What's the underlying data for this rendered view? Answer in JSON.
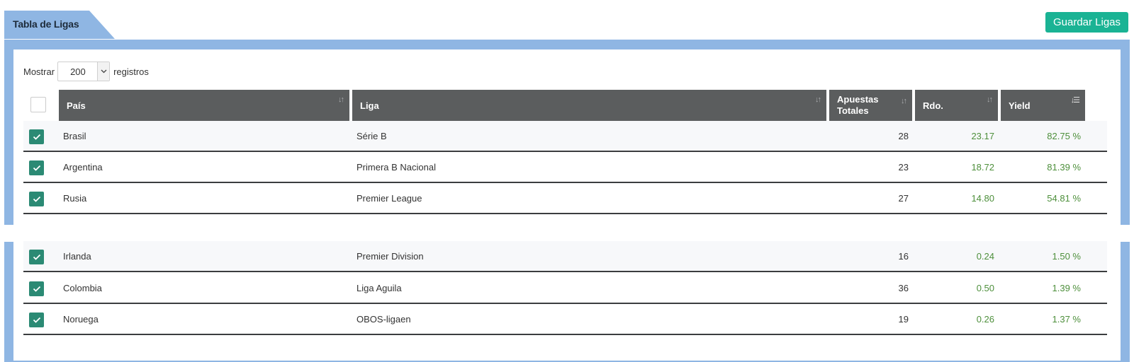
{
  "header": {
    "title": "Tabla de Ligas",
    "save_label": "Guardar Ligas"
  },
  "length": {
    "prefix": "Mostrar",
    "value": "200",
    "suffix": "registros"
  },
  "columns": {
    "pais": "País",
    "liga": "Liga",
    "apuestas_1": "Apuestas",
    "apuestas_2": "Totales",
    "rdo": "Rdo.",
    "yield": "Yield"
  },
  "colors": {
    "accent": "#1ab394",
    "frame": "#8fb6e3",
    "header_bg": "#5b5d5e",
    "checkbox": "#2b8a74",
    "positive": "#4d8f3b"
  },
  "rows": [
    {
      "pais": "Brasil",
      "liga": "Série B",
      "apuestas": "28",
      "rdo": "23.17",
      "yield": "82.75 %"
    },
    {
      "pais": "Argentina",
      "liga": "Primera B Nacional",
      "apuestas": "23",
      "rdo": "18.72",
      "yield": "81.39 %"
    },
    {
      "pais": "Rusia",
      "liga": "Premier League",
      "apuestas": "27",
      "rdo": "14.80",
      "yield": "54.81 %"
    },
    {
      "pais": "Irlanda",
      "liga": "Premier Division",
      "apuestas": "16",
      "rdo": "0.24",
      "yield": "1.50 %"
    },
    {
      "pais": "Colombia",
      "liga": "Liga Aguila",
      "apuestas": "36",
      "rdo": "0.50",
      "yield": "1.39 %"
    },
    {
      "pais": "Noruega",
      "liga": "OBOS-ligaen",
      "apuestas": "19",
      "rdo": "0.26",
      "yield": "1.37 %"
    }
  ]
}
